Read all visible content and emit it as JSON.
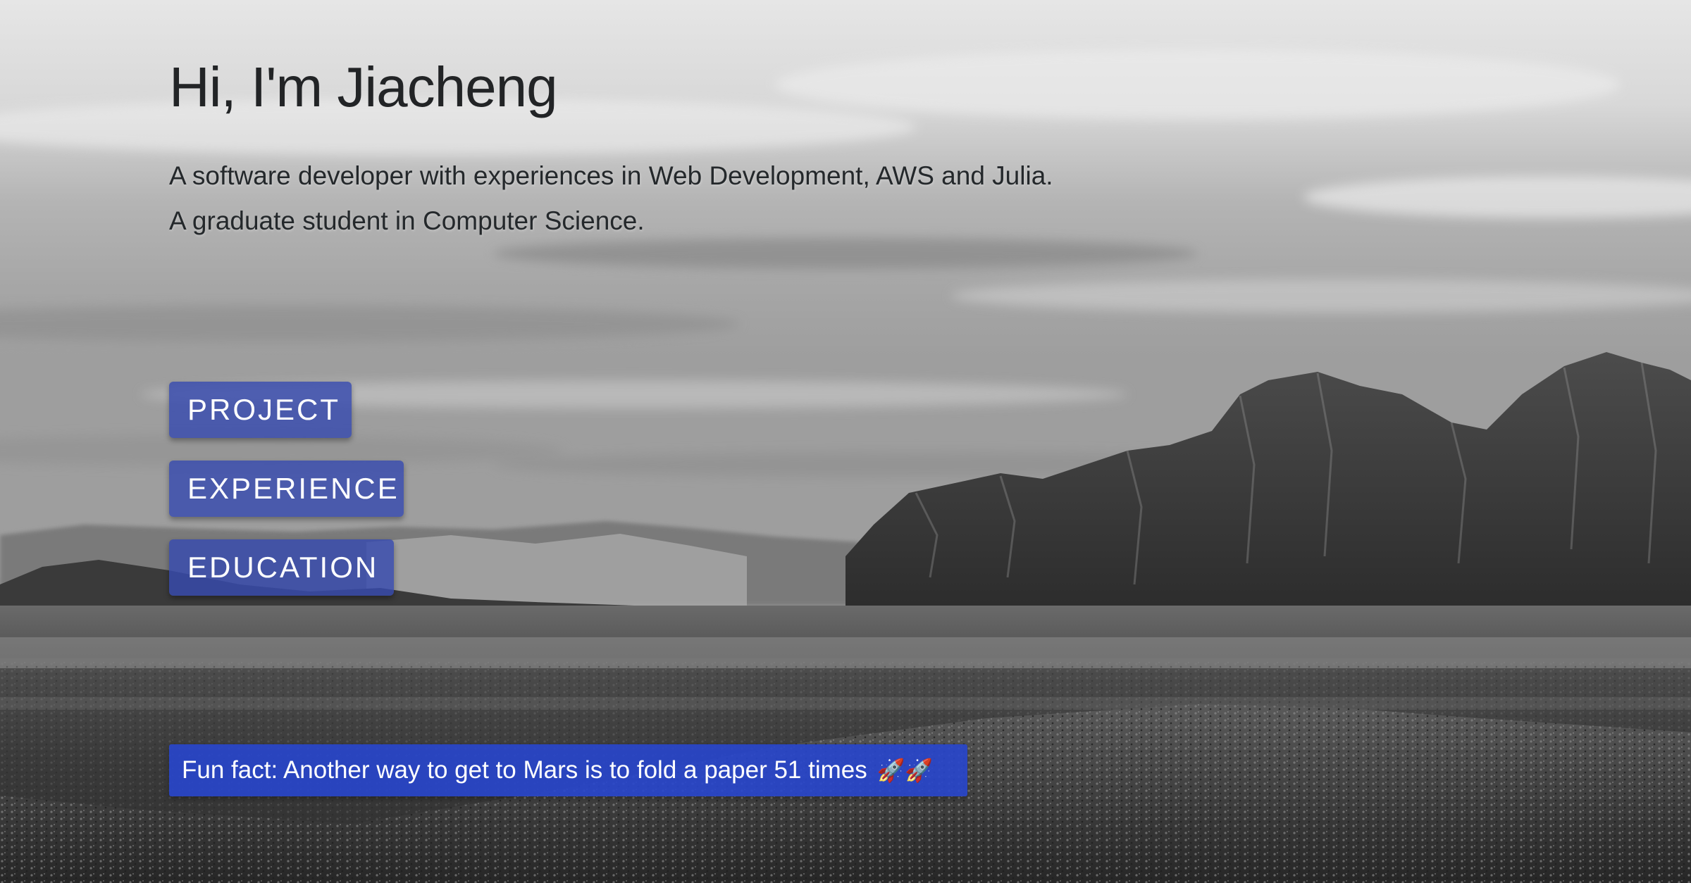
{
  "hero": {
    "greeting": "Hi, I'm Jiacheng",
    "intro_line_1": "A software developer with experiences in Web Development, AWS and Julia.",
    "intro_line_2": "A graduate student in Computer Science."
  },
  "nav": {
    "project_label": "PROJECT",
    "experience_label": "EXPERIENCE",
    "education_label": "EDUCATION"
  },
  "fun_fact": {
    "text": "Fun fact: Another way to get to Mars is to fold a paper 51 times",
    "emoji": "🚀🚀",
    "icon": "rocket-icon"
  },
  "colors": {
    "button_bg": "#3a4bb0",
    "fun_fact_bg": "#2846cd",
    "text_dark": "#222426"
  }
}
